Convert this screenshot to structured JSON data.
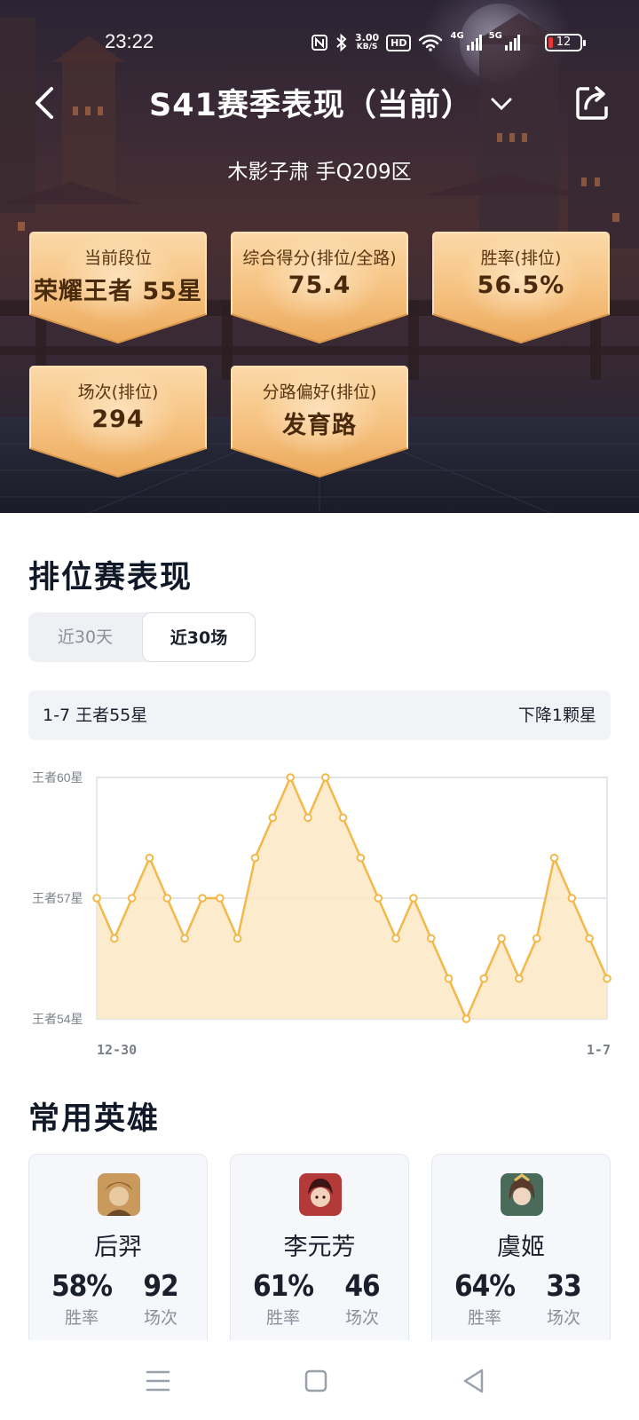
{
  "status_bar": {
    "time": "23:22",
    "net_speed_value": "3.00",
    "net_speed_unit": "KB/S",
    "hd_label": "HD",
    "net_4g": "4G",
    "net_5g": "5G",
    "battery": "12"
  },
  "header": {
    "title": "S41赛季表现（当前）",
    "subtitle": "木影子肃  手Q209区"
  },
  "summary_cards": [
    {
      "label": "当前段位",
      "value": "荣耀王者 55星"
    },
    {
      "label": "综合得分(排位/全路)",
      "value": "75.4"
    },
    {
      "label": "胜率(排位)",
      "value": "56.5%"
    },
    {
      "label": "场次(排位)",
      "value": "294"
    },
    {
      "label": "分路偏好(排位)",
      "value": "发育路"
    }
  ],
  "ranked": {
    "section_title": "排位赛表现",
    "tabs": [
      "近30天",
      "近30场"
    ],
    "active_tab": "近30场",
    "info_left": "1-7 王者55星",
    "info_right": "下降1颗星"
  },
  "chart_data": {
    "type": "area",
    "y_tick_labels": [
      "王者60星",
      "王者57星",
      "王者54星"
    ],
    "y_tick_values": [
      60,
      57,
      54
    ],
    "ylim": [
      54,
      60
    ],
    "x_tick_labels": [
      "12-30",
      "1-7"
    ],
    "values": [
      57,
      56,
      57,
      58,
      57,
      56,
      57,
      57,
      56,
      58,
      59,
      60,
      59,
      60,
      59,
      58,
      57,
      56,
      57,
      56,
      55,
      54,
      55,
      56,
      55,
      56,
      58,
      57,
      56,
      55
    ],
    "colors": {
      "line": "#f4b84a",
      "fill": "#fde8c6",
      "grid": "#dcdfe5"
    }
  },
  "heroes": {
    "section_title": "常用英雄",
    "win_label": "胜率",
    "games_label": "场次",
    "items": [
      {
        "name": "后羿",
        "win_rate": "58%",
        "games": "92",
        "icon": "houyi-avatar-icon"
      },
      {
        "name": "李元芳",
        "win_rate": "61%",
        "games": "46",
        "icon": "liyuanfang-avatar-icon"
      },
      {
        "name": "虞姬",
        "win_rate": "64%",
        "games": "33",
        "icon": "yuji-avatar-icon"
      }
    ]
  },
  "nav": {
    "icons": [
      "menu-icon",
      "home-square-icon",
      "back-triangle-icon"
    ]
  },
  "colors": {
    "card_gold": "#f2b66c",
    "card_gold_light": "#f9d4a0",
    "text_dark": "#1a1f2b",
    "muted": "#8a8f99"
  }
}
